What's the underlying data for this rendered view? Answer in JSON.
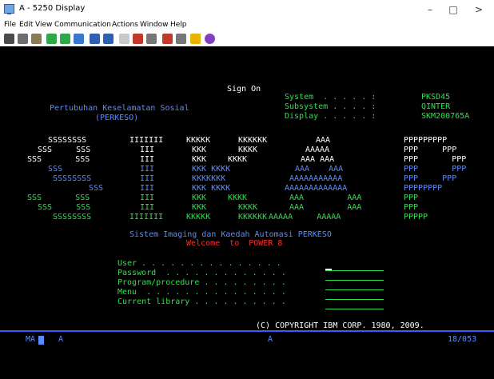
{
  "window": {
    "title": "A - 5250 Display",
    "minimize": "–",
    "maximize": "□",
    "close": ">"
  },
  "menu": [
    "File",
    "Edit",
    "View",
    "Communication",
    "Actions",
    "Window",
    "Help"
  ],
  "toolbar": {
    "icons": [
      "print-screen-icon",
      "copy-icon",
      "paste-icon",
      "send-file-icon",
      "receive-file-icon",
      "display-icon",
      "keyboard-map-icon",
      "macro-icon",
      "record-macro-icon",
      "play-macro-icon",
      "stop-macro-icon",
      "customize-icon",
      "notes-icon",
      "help-icon"
    ]
  },
  "screen": {
    "title": "Sign On",
    "system_label": "System  . . . . . :",
    "system_value": "PKSD45",
    "subsystem_label": "Subsystem . . . . :",
    "subsystem_value": "QINTER",
    "display_label": "Display . . . . . :",
    "display_value": "SKM200765A",
    "org_name": "Pertubuhan Keselamatan Sosial",
    "org_short": "(PERKESO)",
    "banner": {
      "sip": [
        "SSSSSSSS",
        "SSS     SSS",
        "SSS       SSS",
        "SSS",
        "SSSSSSSS",
        "SSS",
        "SSS       SSS",
        "SSS     SSS",
        "SSSSSSSS"
      ],
      "sip_i": [
        "IIIIIII",
        "III",
        "III",
        "III",
        "III",
        "III",
        "III",
        "III",
        "IIIIIII"
      ],
      "k1": [
        "KKKKK",
        "KKK",
        "KKK",
        "KKK KKKK",
        "KKKKKKK",
        "KKK KKKK",
        "KKK",
        "KKK",
        "KKKKK"
      ],
      "k2": [
        "KKKKKK",
        "KKKK",
        "KKKK",
        "",
        "",
        "",
        "KKKK",
        "KKKK",
        "KKKKKK"
      ],
      "a1": [
        "AAA",
        "AAAAA",
        "AAA AAA",
        "AAA    AAA",
        "AAAAAAAAAAA",
        "AAAAAAAAAAAAA",
        "AAA         AAA",
        "AAA         AAA",
        "AAAAA     AAAAA"
      ],
      "p": [
        "PPPPPPPPP",
        "PPP     PPP",
        "PPP       PPP",
        "PPP       PPP",
        "PPP     PPP",
        "PPPPPPPP",
        "PPP",
        "PPP",
        "PPPPP"
      ]
    },
    "system_line": "Sistem Imaging dan Kaedah Automasi PERKESO",
    "welcome": "Welcome  to  POWER 8",
    "fields": [
      {
        "label": "User . . . . . . . . . . . . . . ."
      },
      {
        "label": "Password  . . . . . . . . . . . . ."
      },
      {
        "label": "Program/procedure . . . . . . . . ."
      },
      {
        "label": "Menu  . . . . . . . . . . . . . . ."
      },
      {
        "label": "Current library . . . . . . . . . ."
      }
    ],
    "copyright": "(C) COPYRIGHT IBM CORP. 1980, 2009."
  },
  "status": {
    "mode": "MA",
    "session": "A",
    "indicator": "A",
    "position": "18/053"
  }
}
